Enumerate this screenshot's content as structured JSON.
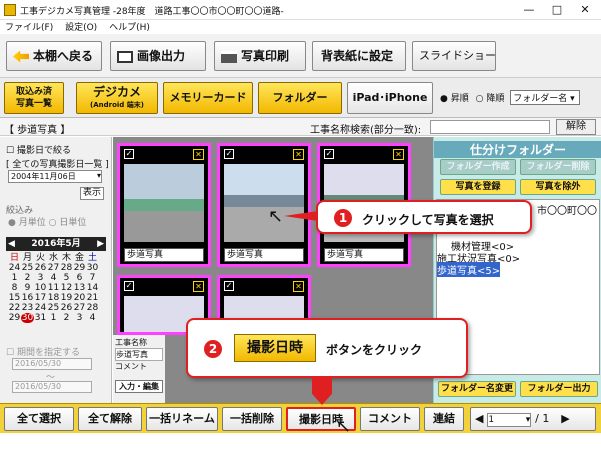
{
  "window": {
    "title": "工事デジカメ写真管理 -28年度　道路工事〇〇市〇〇町〇〇道路-",
    "minimize": "—",
    "maximize": "□",
    "close": "✕"
  },
  "menu": [
    "ファイル(F)",
    "設定(O)",
    "ヘルプ(H)"
  ],
  "toolbar1": {
    "back": "本棚へ戻る",
    "image_out": "画像出力",
    "photo_print": "写真印刷",
    "wallpaper": "背表紙に設定",
    "slideshow": "スライドショー"
  },
  "toolbar2": {
    "imported_1": "取込み済",
    "imported_2": "写真一覧",
    "digicam": "デジカメ",
    "digicam_sub": "(Android 端末)",
    "memory_card": "メモリーカード",
    "folder": "フォルダー",
    "ipad": "iPad･iPhone"
  },
  "sort": {
    "asc": "昇順",
    "desc": "降順",
    "field": "フォルダー名"
  },
  "project": {
    "folder_label": "【 歩道写真 】",
    "search_label": "工事名称検索(部分一致):",
    "search_value": "",
    "clear": "解除"
  },
  "left": {
    "shoot_date_filter": "撮影日で絞る",
    "all_dates": "[ 全ての写真撮影日一覧 ]",
    "date_value": "2004年11月06日",
    "show": "表示",
    "narrow": "絞込み",
    "month_unit": "月単位",
    "day_unit": "日単位",
    "month_title": "2016年5月",
    "weekdays": [
      "日",
      "月",
      "火",
      "水",
      "木",
      "金",
      "土"
    ],
    "weeks": [
      [
        "24",
        "25",
        "26",
        "27",
        "28",
        "29",
        "30"
      ],
      [
        "1",
        "2",
        "3",
        "4",
        "5",
        "6",
        "7"
      ],
      [
        "8",
        "9",
        "10",
        "11",
        "12",
        "13",
        "14"
      ],
      [
        "15",
        "16",
        "17",
        "18",
        "19",
        "20",
        "21"
      ],
      [
        "22",
        "23",
        "24",
        "25",
        "26",
        "27",
        "28"
      ],
      [
        "29",
        "30",
        "31",
        "1",
        "2",
        "3",
        "4"
      ]
    ],
    "period": "期間を指定する",
    "from": "2016/05/30",
    "wave": "〜",
    "to": "2016/05/30"
  },
  "photos": [
    {
      "label": "歩道写真"
    },
    {
      "label": "歩道写真"
    },
    {
      "label": "歩道写真"
    },
    {
      "label": ""
    },
    {
      "label": ""
    }
  ],
  "detail": {
    "name_label": "工事名称",
    "name_value": "歩道写真",
    "comment_label": "コメント",
    "edit": "入力・編集"
  },
  "right": {
    "title": "仕分けフォルダー",
    "create": "フォルダー作成",
    "delete": "フォルダー削除",
    "register": "写真を登録",
    "remove": "写真を除外",
    "tree_top": "市〇〇町〇〇",
    "tree_1": "機材管理<0>",
    "tree_2": "施工状況写真<0>",
    "tree_3": "歩道写真<5>",
    "rename": "フォルダー名変更",
    "output": "フォルダー出力"
  },
  "bottom": {
    "select_all": "全て選択",
    "deselect_all": "全て解除",
    "rename_all": "一括リネーム",
    "delete_all": "一括削除",
    "shoot_date": "撮影日時",
    "comment": "コメント",
    "join": "連結",
    "page": "1",
    "total": "/ 1"
  },
  "callouts": {
    "c1_num": "1",
    "c1_text": "クリックして写真を選択",
    "c2_num": "2",
    "c2_key": "撮影日時",
    "c2_text": "ボタンをクリック"
  },
  "colors": {
    "accent_red": "#e02020",
    "yellow": "#f2d23a",
    "magenta": "#ff40ff",
    "panel_teal": "#c9ebe7"
  }
}
